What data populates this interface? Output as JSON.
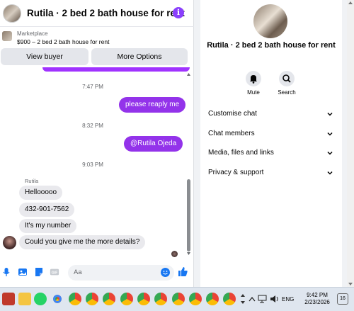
{
  "header": {
    "title": "Rutila · 2 bed 2 bath house for rent",
    "info_icon_glyph": "i"
  },
  "listing": {
    "caption": "Marketplace",
    "detail": "$900 – 2 bed 2 bath house for rent"
  },
  "actions": {
    "view_buyer": "View buyer",
    "more_options": "More Options"
  },
  "messages": {
    "ts1": "7:47 PM",
    "out1": "please reaply me",
    "ts2": "8:32 PM",
    "out2": "@Rutila Ojeda",
    "ts3": "9:03 PM",
    "sender": "Rutila",
    "in1": "Hellooooo",
    "in2": "432-901-7562",
    "in3": "It's my number",
    "in4": "Could you give me the more details?"
  },
  "composer": {
    "placeholder": "Aa"
  },
  "info_panel": {
    "name": "Rutila · 2 bed 2 bath house for rent",
    "mute": "Mute",
    "search": "Search",
    "sections": [
      "Customise chat",
      "Chat members",
      "Media, files and links",
      "Privacy & support"
    ]
  },
  "taskbar": {
    "lang": "ENG",
    "time": "9:42 PM",
    "date": "2/23/2026",
    "notif_count": "16"
  },
  "colors": {
    "accent_purple": "#9333ea",
    "messenger_blue": "#1877f2"
  }
}
